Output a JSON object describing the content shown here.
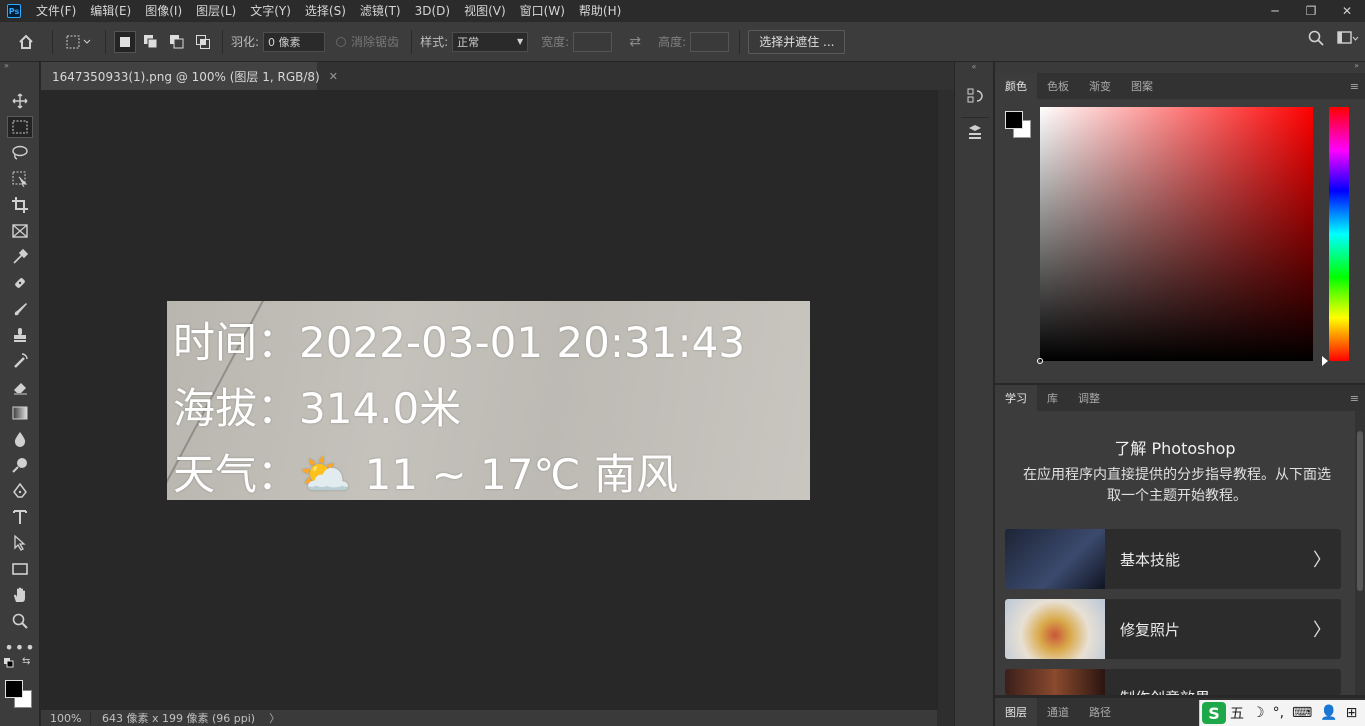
{
  "app": {
    "logo": "Ps"
  },
  "menu": [
    "文件(F)",
    "编辑(E)",
    "图像(I)",
    "图层(L)",
    "文字(Y)",
    "选择(S)",
    "滤镜(T)",
    "3D(D)",
    "视图(V)",
    "窗口(W)",
    "帮助(H)"
  ],
  "window_controls": {
    "minimize": "─",
    "restore": "❐",
    "close": "✕"
  },
  "options": {
    "feather_label": "羽化:",
    "feather_value": "0 像素",
    "antialias_label": "消除锯齿",
    "style_label": "样式:",
    "style_value": "正常",
    "width_label": "宽度:",
    "height_label": "高度:",
    "select_mask_button": "选择并遮住 ..."
  },
  "document": {
    "tab_title": "1647350933(1).png @ 100% (图层 1, RGB/8)",
    "image_lines": [
      "时间：2022-03-01 20:31:43",
      "海拔：314.0米",
      "天气：⛅ 11 ~ 17℃ 南风"
    ]
  },
  "status": {
    "zoom": "100%",
    "dimensions": "643 像素 x 199 像素 (96 ppi)",
    "arrow": "〉"
  },
  "color_panel": {
    "tabs": [
      "颜色",
      "色板",
      "渐变",
      "图案"
    ],
    "active_tab": 0
  },
  "learn_panel": {
    "tabs": [
      "学习",
      "库",
      "调整"
    ],
    "title": "了解 Photoshop",
    "description": "在应用程序内直接提供的分步指导教程。从下面选取一个主题开始教程。",
    "cards": [
      {
        "label": "基本技能",
        "thumb_color": "#1d2436"
      },
      {
        "label": "修复照片",
        "thumb_color": "#c9b48a"
      },
      {
        "label": "制作创意效果",
        "thumb_color": "#6b3b2b"
      }
    ]
  },
  "layers_panel": {
    "tabs": [
      "图层",
      "通道",
      "路径"
    ]
  },
  "ime": {
    "logo": "S",
    "mode": "五",
    "icons": [
      "☽",
      "°,",
      "⌨",
      "👤",
      "⊞"
    ]
  }
}
